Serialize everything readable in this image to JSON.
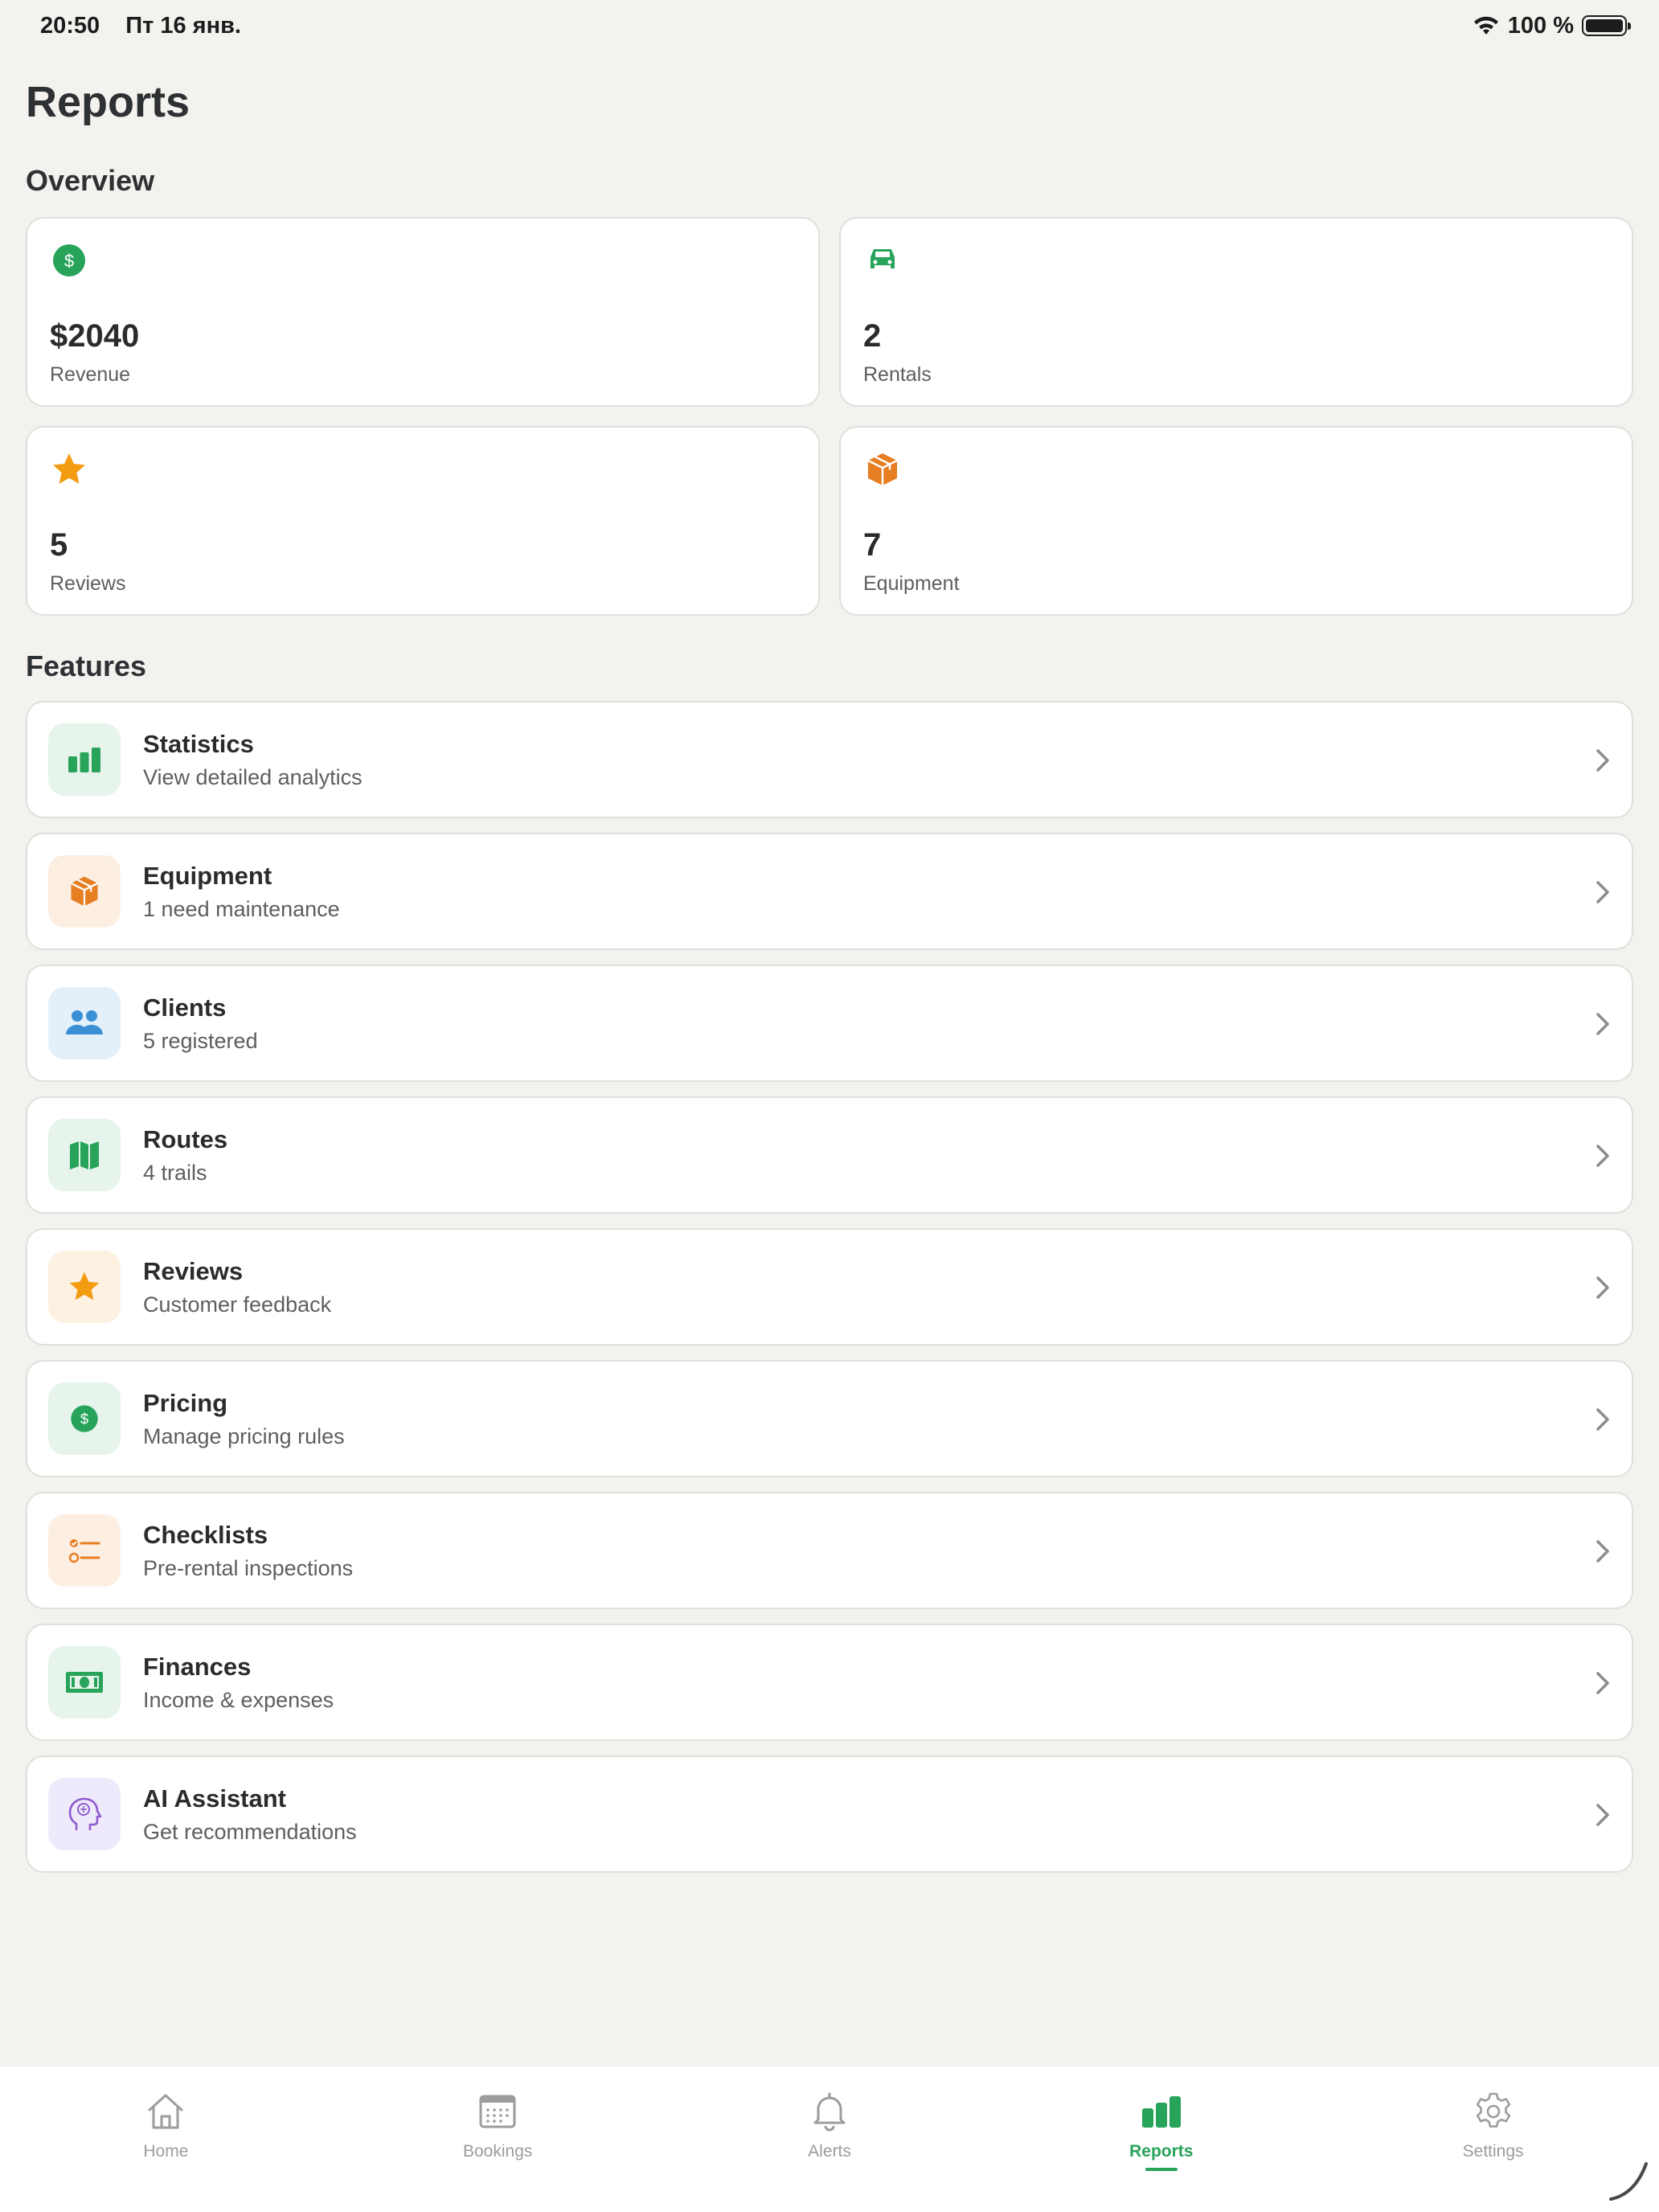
{
  "status": {
    "time": "20:50",
    "date": "Пт 16 янв.",
    "battery": "100 %"
  },
  "page": {
    "title": "Reports"
  },
  "overview": {
    "heading": "Overview",
    "cards": [
      {
        "icon": "dollar-circle-icon",
        "value": "$2040",
        "label": "Revenue",
        "color": "#27a35a"
      },
      {
        "icon": "car-icon",
        "value": "2",
        "label": "Rentals",
        "color": "#27a35a"
      },
      {
        "icon": "star-icon",
        "value": "5",
        "label": "Reviews",
        "color": "#f39c12"
      },
      {
        "icon": "box-icon",
        "value": "7",
        "label": "Equipment",
        "color": "#e67e22"
      }
    ]
  },
  "features": {
    "heading": "Features",
    "items": [
      {
        "icon": "bar-chart-icon",
        "title": "Statistics",
        "subtitle": "View detailed analytics",
        "bg": "#e6f4ec"
      },
      {
        "icon": "box-icon",
        "title": "Equipment",
        "subtitle": "1 need maintenance",
        "bg": "#fdeee2"
      },
      {
        "icon": "people-icon",
        "title": "Clients",
        "subtitle": "5 registered",
        "bg": "#e3f0fa"
      },
      {
        "icon": "map-icon",
        "title": "Routes",
        "subtitle": "4 trails",
        "bg": "#e6f4ec"
      },
      {
        "icon": "star-icon",
        "title": "Reviews",
        "subtitle": "Customer feedback",
        "bg": "#fdf1e2"
      },
      {
        "icon": "dollar-circle-icon",
        "title": "Pricing",
        "subtitle": "Manage pricing rules",
        "bg": "#e6f4ec"
      },
      {
        "icon": "checklist-icon",
        "title": "Checklists",
        "subtitle": "Pre-rental inspections",
        "bg": "#fdeee2"
      },
      {
        "icon": "banknote-icon",
        "title": "Finances",
        "subtitle": "Income & expenses",
        "bg": "#e6f4ec"
      },
      {
        "icon": "brain-head-icon",
        "title": "AI Assistant",
        "subtitle": "Get recommendations",
        "bg": "#efeafb"
      }
    ]
  },
  "tabs": [
    {
      "icon": "home-icon",
      "label": "Home",
      "active": false
    },
    {
      "icon": "calendar-icon",
      "label": "Bookings",
      "active": false
    },
    {
      "icon": "bell-icon",
      "label": "Alerts",
      "active": false
    },
    {
      "icon": "bar-chart-icon",
      "label": "Reports",
      "active": true
    },
    {
      "icon": "gear-icon",
      "label": "Settings",
      "active": false
    }
  ],
  "colors": {
    "accent": "#27a35a",
    "orange": "#e67e22",
    "star": "#f39c12",
    "blue": "#3b8fd4",
    "purple": "#8e5bd1"
  }
}
